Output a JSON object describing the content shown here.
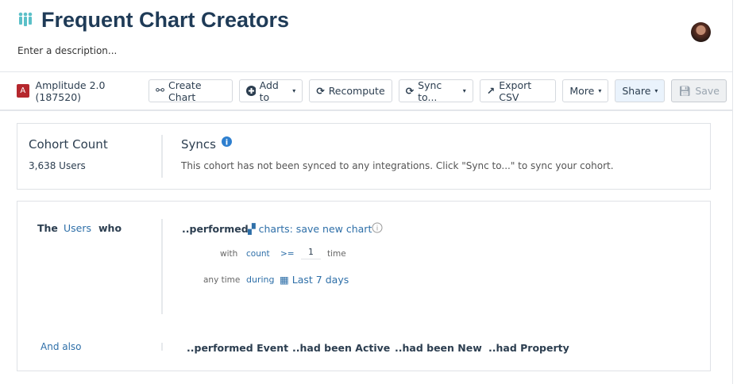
{
  "header": {
    "title": "Frequent Chart Creators",
    "description_placeholder": "Enter a description..."
  },
  "toolbar": {
    "project_badge": "A",
    "project": "Amplitude 2.0 (187520)",
    "create_chart": "Create Chart",
    "add_to": "Add to",
    "recompute": "Recompute",
    "sync_to": "Sync to...",
    "export_csv": "Export CSV",
    "more": "More",
    "share": "Share",
    "save": "Save"
  },
  "summary": {
    "count_label": "Cohort Count",
    "count_value": "3,638 Users",
    "syncs_title": "Syncs",
    "syncs_text": "This cohort has not been synced to any integrations. Click \"Sync to...\" to sync your cohort."
  },
  "definition": {
    "the": "The",
    "users": "Users",
    "who": "who",
    "performed": "..performed",
    "event": "charts: save new chart",
    "with": "with",
    "count": "count",
    "op": ">=",
    "value": "1",
    "time": "time",
    "any_time": "any time",
    "during": "during",
    "range": "Last 7 days",
    "and_also": "And also",
    "options": [
      "..performed Event",
      "..had been Active",
      "..had been New",
      "..had Property"
    ]
  },
  "colors": {
    "accent": "#2e6fa8",
    "title": "#1f3b57",
    "badge": "#b5272d",
    "icon_teal": "#5bc0c8"
  }
}
